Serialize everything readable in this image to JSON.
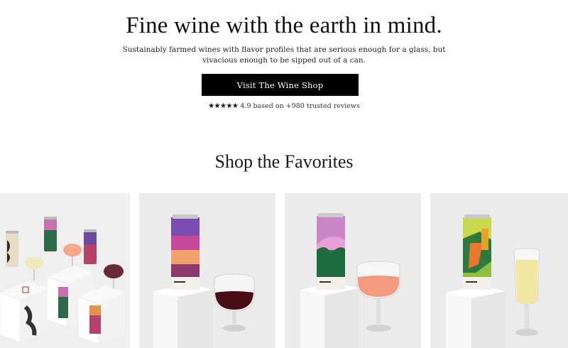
{
  "hero": {
    "title": "Fine wine with the earth in mind.",
    "subtitle": "Sustainably farmed wines with flavor profiles that are serious enough for a glass, but vivacious enough to be sipped out of a can.",
    "cta_label": "Visit The Wine Shop",
    "rating": {
      "stars_glyphs": "★★★★★",
      "score": 4.9,
      "text": "4.9 based on +980 trusted reviews"
    }
  },
  "favorites": {
    "title": "Shop the Favorites",
    "products": [
      {
        "id": "bundle",
        "image": "wine-can-bundle-image"
      },
      {
        "id": "red",
        "image": "red-wine-can-image"
      },
      {
        "id": "rose",
        "image": "rose-wine-can-image"
      },
      {
        "id": "sparkling",
        "image": "sparkling-wine-can-image"
      }
    ]
  },
  "colors": {
    "cta_background": "#000000",
    "cta_text": "#ffffff",
    "card_background": "#ebebeb"
  }
}
